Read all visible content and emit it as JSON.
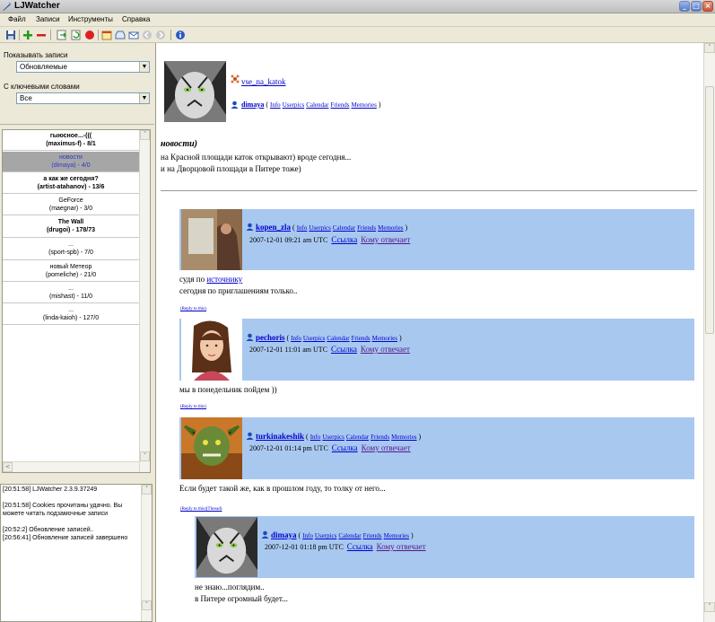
{
  "window": {
    "title": "LJWatcher",
    "min": "_",
    "max": "□",
    "close": "×"
  },
  "menu": [
    "Файл",
    "Записи",
    "Инструменты",
    "Справка"
  ],
  "filters": {
    "show_label": "Показывать записи",
    "show_value": "Обновляемые",
    "keywords_label": "С ключевыми словами",
    "keywords_value": "Все"
  },
  "posts": [
    {
      "title": "гыюсное...-(((",
      "author": "(maximus-f) - 8/1",
      "bold": true
    },
    {
      "title": "новости",
      "author": "(dimaya) - 4/0",
      "selected": true
    },
    {
      "title": "а как же сегодня?",
      "author": "(artist-atahanov) - 13/6",
      "bold": true
    },
    {
      "title": "GeForce",
      "author": "(maegnar) - 3/0"
    },
    {
      "title": "The Wall",
      "author": "(drugoi) - 178/73",
      "bold": true
    },
    {
      "title": "...",
      "author": "(sport-spb) - 7/0"
    },
    {
      "title": "новый Метеор",
      "author": "(pomeliche) - 21/0"
    },
    {
      "title": "...",
      "author": "(mishast) - 11/0"
    },
    {
      "title": "...",
      "author": "(linda-kaioh) - 127/0"
    }
  ],
  "log": [
    "[20:51:58] LJWatcher 2.3.9.37249",
    "[20:51:58] Cookies прочитаны удачно. Вы можете читать подзамочные записи",
    "[20:52:2] Обновление записей..",
    "[20:56:41] Обновление записей завершено"
  ],
  "post": {
    "community": "vse_na_katok",
    "author": "dimaya",
    "links": [
      "Info",
      "Userpics",
      "Calendar",
      "Friends",
      "Memories"
    ],
    "title": "новости)",
    "body1": "на Красной площади каток открывают) вроде сегодня...",
    "body2": "и на Дворцовой площади в Питере тоже)"
  },
  "comments": [
    {
      "user": "kopen_zla",
      "date": "2007-12-01 09:21 am UTC",
      "link1": "Ссылка",
      "link2": "Кому отвечает",
      "text1": "судя по ",
      "text_link": "источнику",
      "text2": "сегодня по приглашениям только..",
      "reply": "(Reply to this)"
    },
    {
      "user": "pechoris",
      "date": "2007-12-01 11:01 am UTC",
      "link1": "Ссылка",
      "link2": "Кому отвечает",
      "text1": "мы в понедельник пойдем ))",
      "reply": "(Reply to this)"
    },
    {
      "user": "turkinakeshik",
      "date": "2007-12-01 01:14 pm UTC",
      "link1": "Ссылка",
      "link2": "Кому отвечает",
      "text1": "Если будет такой же, как в прошлом году, то толку от него...",
      "reply": "(Reply to this)",
      "thread": "(Thread)"
    },
    {
      "user": "dimaya",
      "date": "2007-12-01 01:18 pm UTC",
      "link1": "Ссылка",
      "link2": "Кому отвечает",
      "text1": "не знаю...поглядим..",
      "text2": "в Питере огромный будет..."
    }
  ],
  "colors": {
    "comment_bg": "#A8C8F0",
    "link": "#0000CC",
    "selected": "#A6A6A6"
  }
}
